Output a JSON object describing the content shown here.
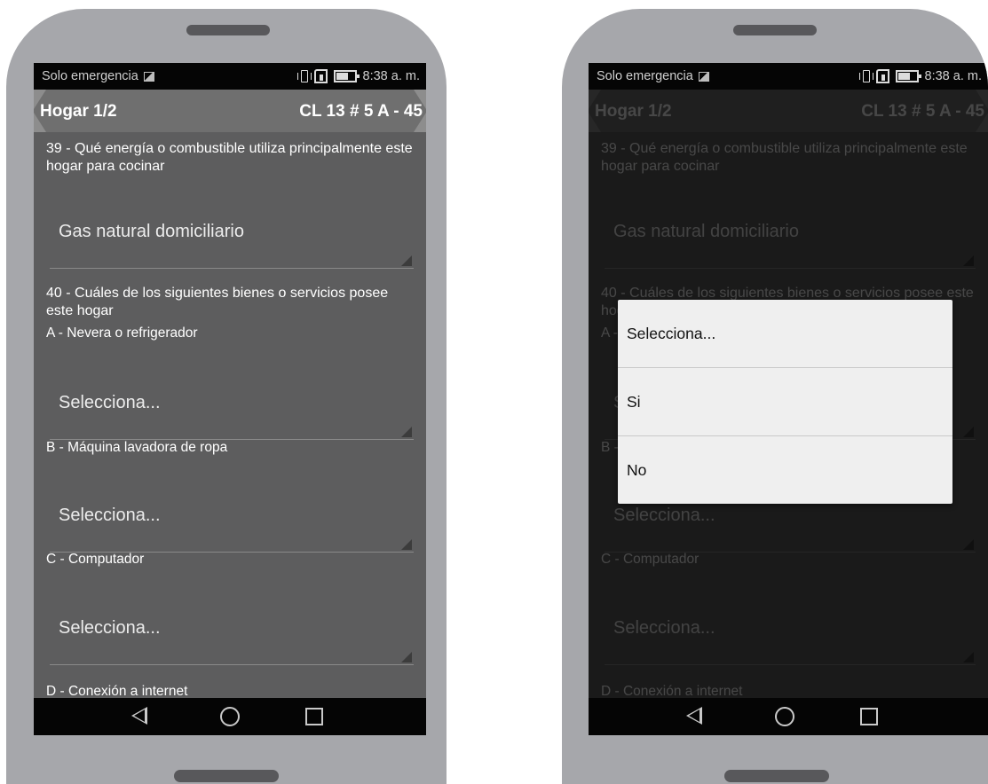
{
  "status_bar": {
    "carrier": "Solo emergencia",
    "time": "8:38 a. m."
  },
  "header": {
    "title": "Hogar 1/2",
    "address": "CL 13 # 5 A - 45"
  },
  "form": {
    "q39": {
      "text": "39 - Qué energía o combustible utiliza principalmente este hogar para cocinar",
      "value": "Gas natural domiciliario"
    },
    "q40": {
      "text": "40 - Cuáles de los siguientes bienes o servicios posee este hogar"
    },
    "items": [
      {
        "label": "A - Nevera o refrigerador",
        "value": "Selecciona..."
      },
      {
        "label": "B - Máquina lavadora de ropa",
        "value": "Selecciona..."
      },
      {
        "label": "C - Computador",
        "value": "Selecciona..."
      },
      {
        "label": "D - Conexión a internet"
      }
    ]
  },
  "dialog": {
    "options": [
      "Selecciona...",
      "Si",
      "No"
    ]
  },
  "colors": {
    "screen_bg": "#5d5d5e",
    "header_bg": "#6f6f6f",
    "phone_frame": "#a6a7ab",
    "dialog_bg": "#efefef"
  },
  "icons": [
    "image-notification-icon",
    "vibrate-icon",
    "rotate-icon",
    "battery-icon",
    "back-icon",
    "home-icon",
    "recent-apps-icon"
  ]
}
